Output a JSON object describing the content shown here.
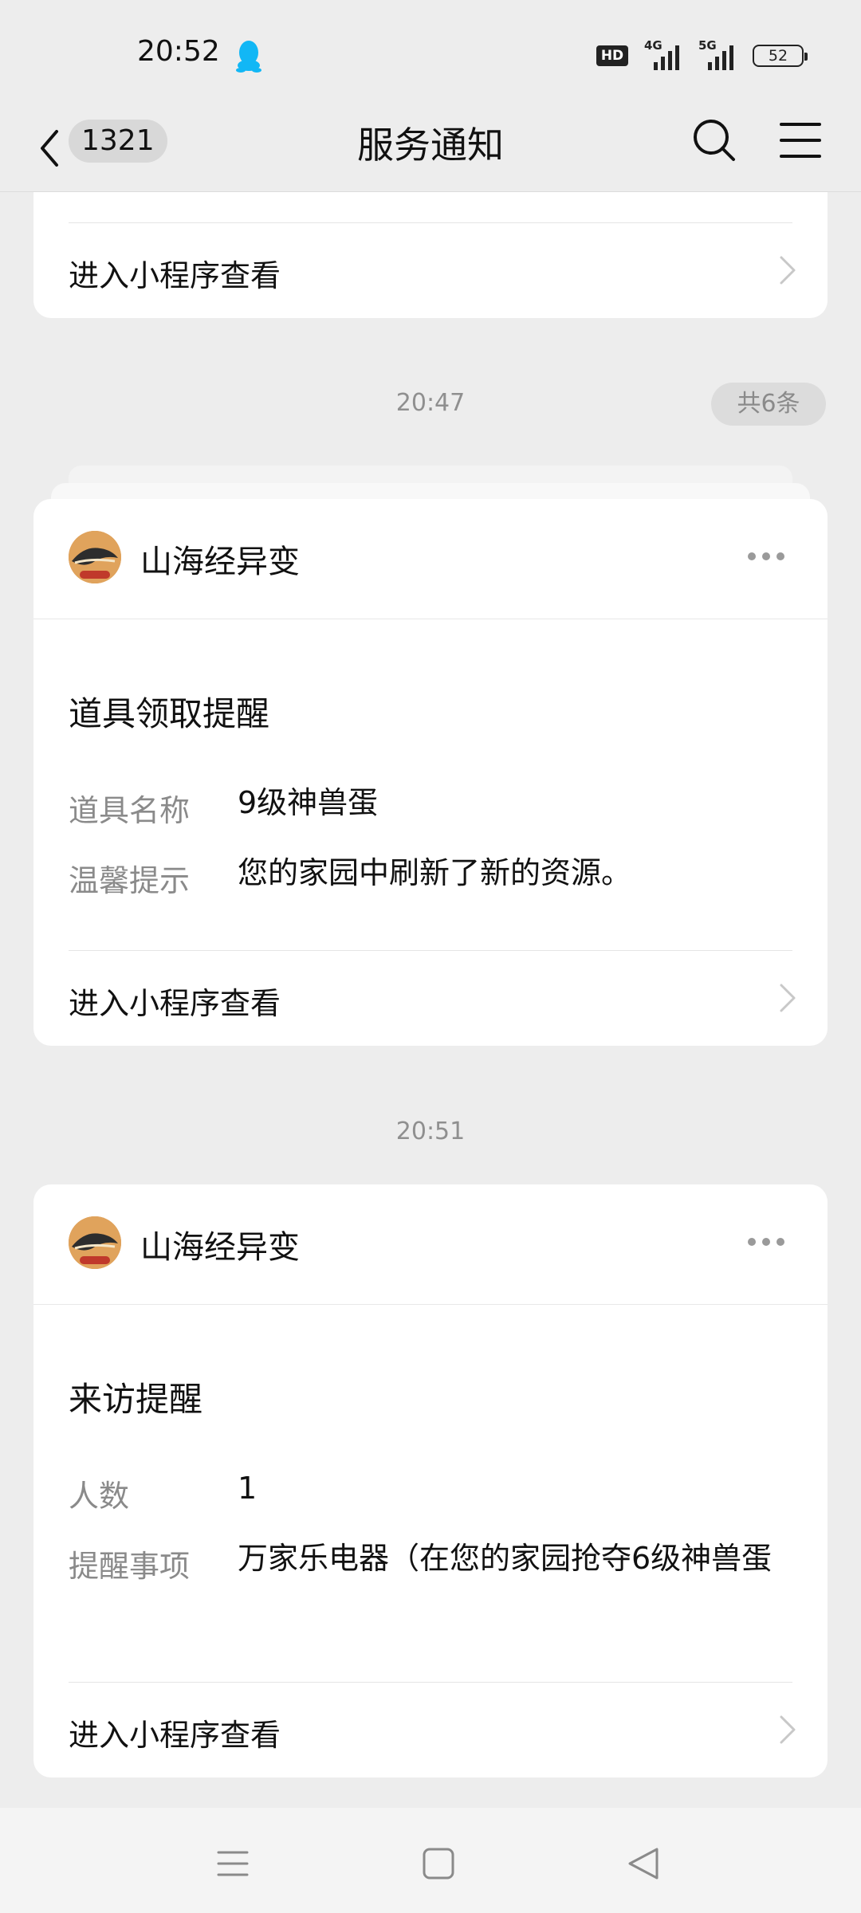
{
  "status_bar": {
    "time": "20:52",
    "net1": "4G",
    "net2": "5G",
    "hd": "HD",
    "battery": "52"
  },
  "nav": {
    "unread_count": "1321",
    "title": "服务通知"
  },
  "top_card": {
    "enter_label": "进入小程序查看"
  },
  "group1": {
    "time": "20:47",
    "count": "共6条"
  },
  "card1": {
    "app_name": "山海经异变",
    "title": "道具领取提醒",
    "fields": [
      {
        "label": "道具名称",
        "value": "9级神兽蛋"
      },
      {
        "label": "温馨提示",
        "value": "您的家园中刷新了新的资源。"
      }
    ],
    "enter_label": "进入小程序查看"
  },
  "group2": {
    "time": "20:51"
  },
  "card2": {
    "app_name": "山海经异变",
    "title": "来访提醒",
    "fields": [
      {
        "label": "人数",
        "value": "1"
      },
      {
        "label": "提醒事项",
        "value": "万家乐电器（在您的家园抢夺6级神兽蛋"
      }
    ],
    "enter_label": "进入小程序查看"
  },
  "icons": [
    "qq-icon",
    "back-icon",
    "search-icon",
    "menu-icon",
    "more-icon",
    "chevron-right-icon",
    "home-menu-icon",
    "home-icon",
    "back-triangle-icon"
  ],
  "colors": {
    "background": "#ededed",
    "card": "#ffffff",
    "label_gray": "#8a8a8a",
    "qq_blue": "#12b7f5"
  }
}
